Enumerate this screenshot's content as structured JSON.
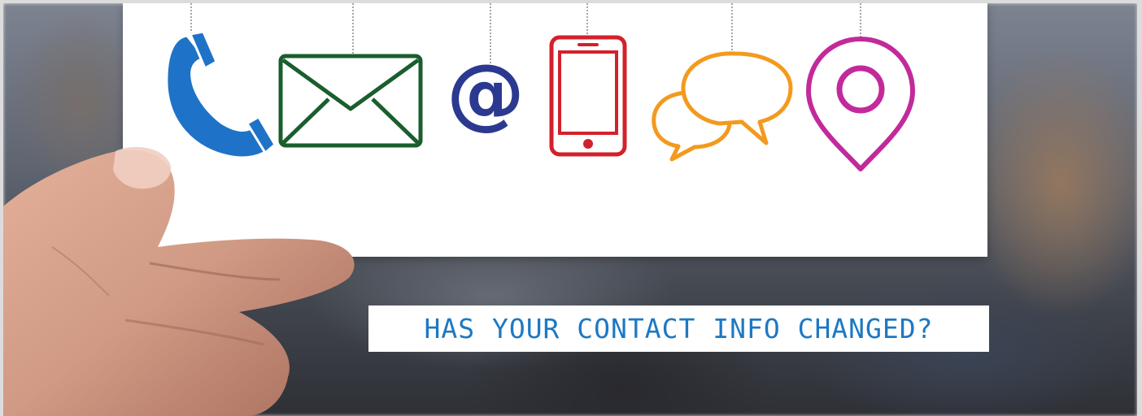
{
  "banner": {
    "text": "HAS YOUR CONTACT INFO CHANGED?"
  },
  "icons": [
    {
      "name": "phone-icon",
      "color": "#1e73c8"
    },
    {
      "name": "envelope-icon",
      "color": "#1a5e2e"
    },
    {
      "name": "at-sign-icon",
      "color": "#2b3990"
    },
    {
      "name": "smartphone-icon",
      "color": "#d3212b"
    },
    {
      "name": "chat-bubbles-icon",
      "color": "#f39a1e"
    },
    {
      "name": "location-pin-icon",
      "color": "#c22a9b"
    }
  ],
  "colors": {
    "banner_text": "#1d78c4",
    "card": "#ffffff"
  }
}
